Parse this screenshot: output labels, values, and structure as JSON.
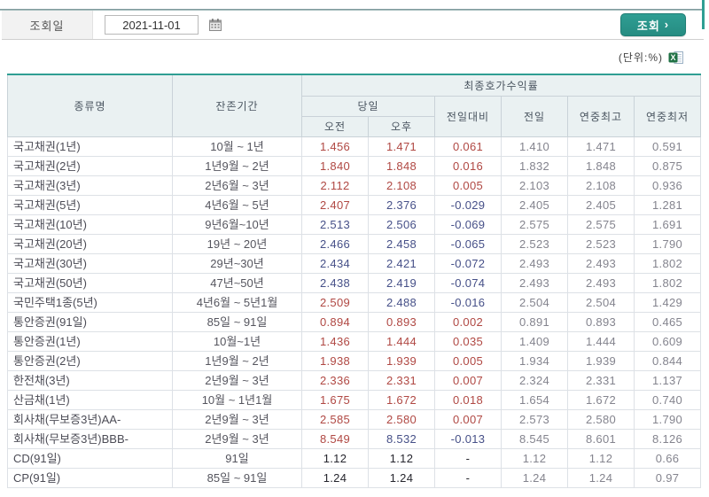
{
  "form": {
    "date_label": "조회일",
    "date_value": "2021-11-01",
    "search_label": "조회",
    "search_arrow": "›"
  },
  "unit_label": "(단위:%)",
  "icons": {
    "calendar": "calendar-grid-glyph",
    "excel": "excel-spreadsheet-glyph",
    "chevron_right": "›"
  },
  "table": {
    "headers": {
      "type": "종류명",
      "period": "잔존기간",
      "yield_group": "최종호가수익률",
      "today": "당일",
      "am": "오전",
      "pm": "오후",
      "vs_prev": "전일대비",
      "prev": "전일",
      "year_high": "연중최고",
      "year_low": "연중최저"
    },
    "rows": [
      {
        "name": "국고채권(1년)",
        "period": "10월 ~ 1년",
        "am": "1.456",
        "am_c": "up",
        "pm": "1.471",
        "pm_c": "up",
        "diff": "0.061",
        "diff_c": "up",
        "prev": "1.410",
        "high": "1.471",
        "low": "0.591"
      },
      {
        "name": "국고채권(2년)",
        "period": "1년9월 ~ 2년",
        "am": "1.840",
        "am_c": "up",
        "pm": "1.848",
        "pm_c": "up",
        "diff": "0.016",
        "diff_c": "up",
        "prev": "1.832",
        "high": "1.848",
        "low": "0.875"
      },
      {
        "name": "국고채권(3년)",
        "period": "2년6월 ~ 3년",
        "am": "2.112",
        "am_c": "up",
        "pm": "2.108",
        "pm_c": "up",
        "diff": "0.005",
        "diff_c": "up",
        "prev": "2.103",
        "high": "2.108",
        "low": "0.936"
      },
      {
        "name": "국고채권(5년)",
        "period": "4년6월 ~ 5년",
        "am": "2.407",
        "am_c": "up",
        "pm": "2.376",
        "pm_c": "down",
        "diff": "-0.029",
        "diff_c": "down",
        "prev": "2.405",
        "high": "2.405",
        "low": "1.281"
      },
      {
        "name": "국고채권(10년)",
        "period": "9년6월~10년",
        "am": "2.513",
        "am_c": "down",
        "pm": "2.506",
        "pm_c": "down",
        "diff": "-0.069",
        "diff_c": "down",
        "prev": "2.575",
        "high": "2.575",
        "low": "1.691"
      },
      {
        "name": "국고채권(20년)",
        "period": "19년 ~ 20년",
        "am": "2.466",
        "am_c": "down",
        "pm": "2.458",
        "pm_c": "down",
        "diff": "-0.065",
        "diff_c": "down",
        "prev": "2.523",
        "high": "2.523",
        "low": "1.790"
      },
      {
        "name": "국고채권(30년)",
        "period": "29년~30년",
        "am": "2.434",
        "am_c": "down",
        "pm": "2.421",
        "pm_c": "down",
        "diff": "-0.072",
        "diff_c": "down",
        "prev": "2.493",
        "high": "2.493",
        "low": "1.802"
      },
      {
        "name": "국고채권(50년)",
        "period": "47년~50년",
        "am": "2.438",
        "am_c": "down",
        "pm": "2.419",
        "pm_c": "down",
        "diff": "-0.074",
        "diff_c": "down",
        "prev": "2.493",
        "high": "2.493",
        "low": "1.802"
      },
      {
        "name": "국민주택1종(5년)",
        "period": "4년6월 ~ 5년1월",
        "am": "2.509",
        "am_c": "up",
        "pm": "2.488",
        "pm_c": "down",
        "diff": "-0.016",
        "diff_c": "down",
        "prev": "2.504",
        "high": "2.504",
        "low": "1.429"
      },
      {
        "name": "통안증권(91일)",
        "period": "85일 ~ 91일",
        "am": "0.894",
        "am_c": "up",
        "pm": "0.893",
        "pm_c": "up",
        "diff": "0.002",
        "diff_c": "up",
        "prev": "0.891",
        "high": "0.893",
        "low": "0.465"
      },
      {
        "name": "통안증권(1년)",
        "period": "10월~1년",
        "am": "1.436",
        "am_c": "up",
        "pm": "1.444",
        "pm_c": "up",
        "diff": "0.035",
        "diff_c": "up",
        "prev": "1.409",
        "high": "1.444",
        "low": "0.609"
      },
      {
        "name": "통안증권(2년)",
        "period": "1년9월 ~ 2년",
        "am": "1.938",
        "am_c": "up",
        "pm": "1.939",
        "pm_c": "up",
        "diff": "0.005",
        "diff_c": "up",
        "prev": "1.934",
        "high": "1.939",
        "low": "0.844"
      },
      {
        "name": "한전채(3년)",
        "period": "2년9월 ~ 3년",
        "am": "2.336",
        "am_c": "up",
        "pm": "2.331",
        "pm_c": "up",
        "diff": "0.007",
        "diff_c": "up",
        "prev": "2.324",
        "high": "2.331",
        "low": "1.137"
      },
      {
        "name": "산금채(1년)",
        "period": "10월 ~ 1년1월",
        "am": "1.675",
        "am_c": "up",
        "pm": "1.672",
        "pm_c": "up",
        "diff": "0.018",
        "diff_c": "up",
        "prev": "1.654",
        "high": "1.672",
        "low": "0.740"
      },
      {
        "name": "회사채(무보증3년)AA-",
        "period": "2년9월 ~ 3년",
        "am": "2.585",
        "am_c": "up",
        "pm": "2.580",
        "pm_c": "up",
        "diff": "0.007",
        "diff_c": "up",
        "prev": "2.573",
        "high": "2.580",
        "low": "1.790"
      },
      {
        "name": "회사채(무보증3년)BBB-",
        "period": "2년9월 ~ 3년",
        "am": "8.549",
        "am_c": "up",
        "pm": "8.532",
        "pm_c": "down",
        "diff": "-0.013",
        "diff_c": "down",
        "prev": "8.545",
        "high": "8.601",
        "low": "8.126"
      },
      {
        "name": "CD(91일)",
        "period": "91일",
        "am": "1.12",
        "am_c": "flat",
        "pm": "1.12",
        "pm_c": "flat",
        "diff": "-",
        "diff_c": "flat",
        "prev": "1.12",
        "high": "1.12",
        "low": "0.66"
      },
      {
        "name": "CP(91일)",
        "period": "85일 ~ 91일",
        "am": "1.24",
        "am_c": "flat",
        "pm": "1.24",
        "pm_c": "flat",
        "diff": "-",
        "diff_c": "flat",
        "prev": "1.24",
        "high": "1.24",
        "low": "0.97"
      }
    ]
  },
  "colors": {
    "accent": "#2f9e93",
    "up": "#b04843",
    "down": "#465088",
    "flat": "#26262e",
    "gray": "#84848e"
  }
}
